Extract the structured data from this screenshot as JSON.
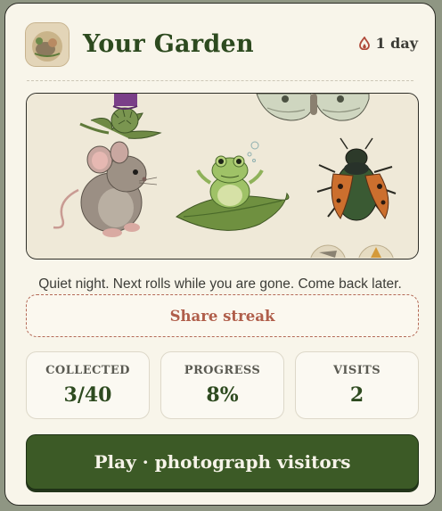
{
  "header": {
    "title": "Your Garden",
    "streak_text": "1 day",
    "avatar_icon": "garden-avatar-icon",
    "streak_icon": "flame-icon"
  },
  "scene": {
    "creatures": [
      "thistle",
      "moth",
      "mouse",
      "frog",
      "beetle"
    ]
  },
  "message": "Quiet night. Next rolls while you are gone. Come back later.",
  "share_label": "Share streak",
  "stats": [
    {
      "label": "COLLECTED",
      "value": "3/40"
    },
    {
      "label": "PROGRESS",
      "value": "8%"
    },
    {
      "label": "VISITS",
      "value": "2"
    }
  ],
  "progress_fraction": 0.08,
  "play_label": "Play · photograph visitors",
  "colors": {
    "primary_green": "#3c5a26",
    "title_green": "#2d4a1f",
    "share_red": "#b05e4a",
    "card_bg": "#f8f5ea"
  }
}
